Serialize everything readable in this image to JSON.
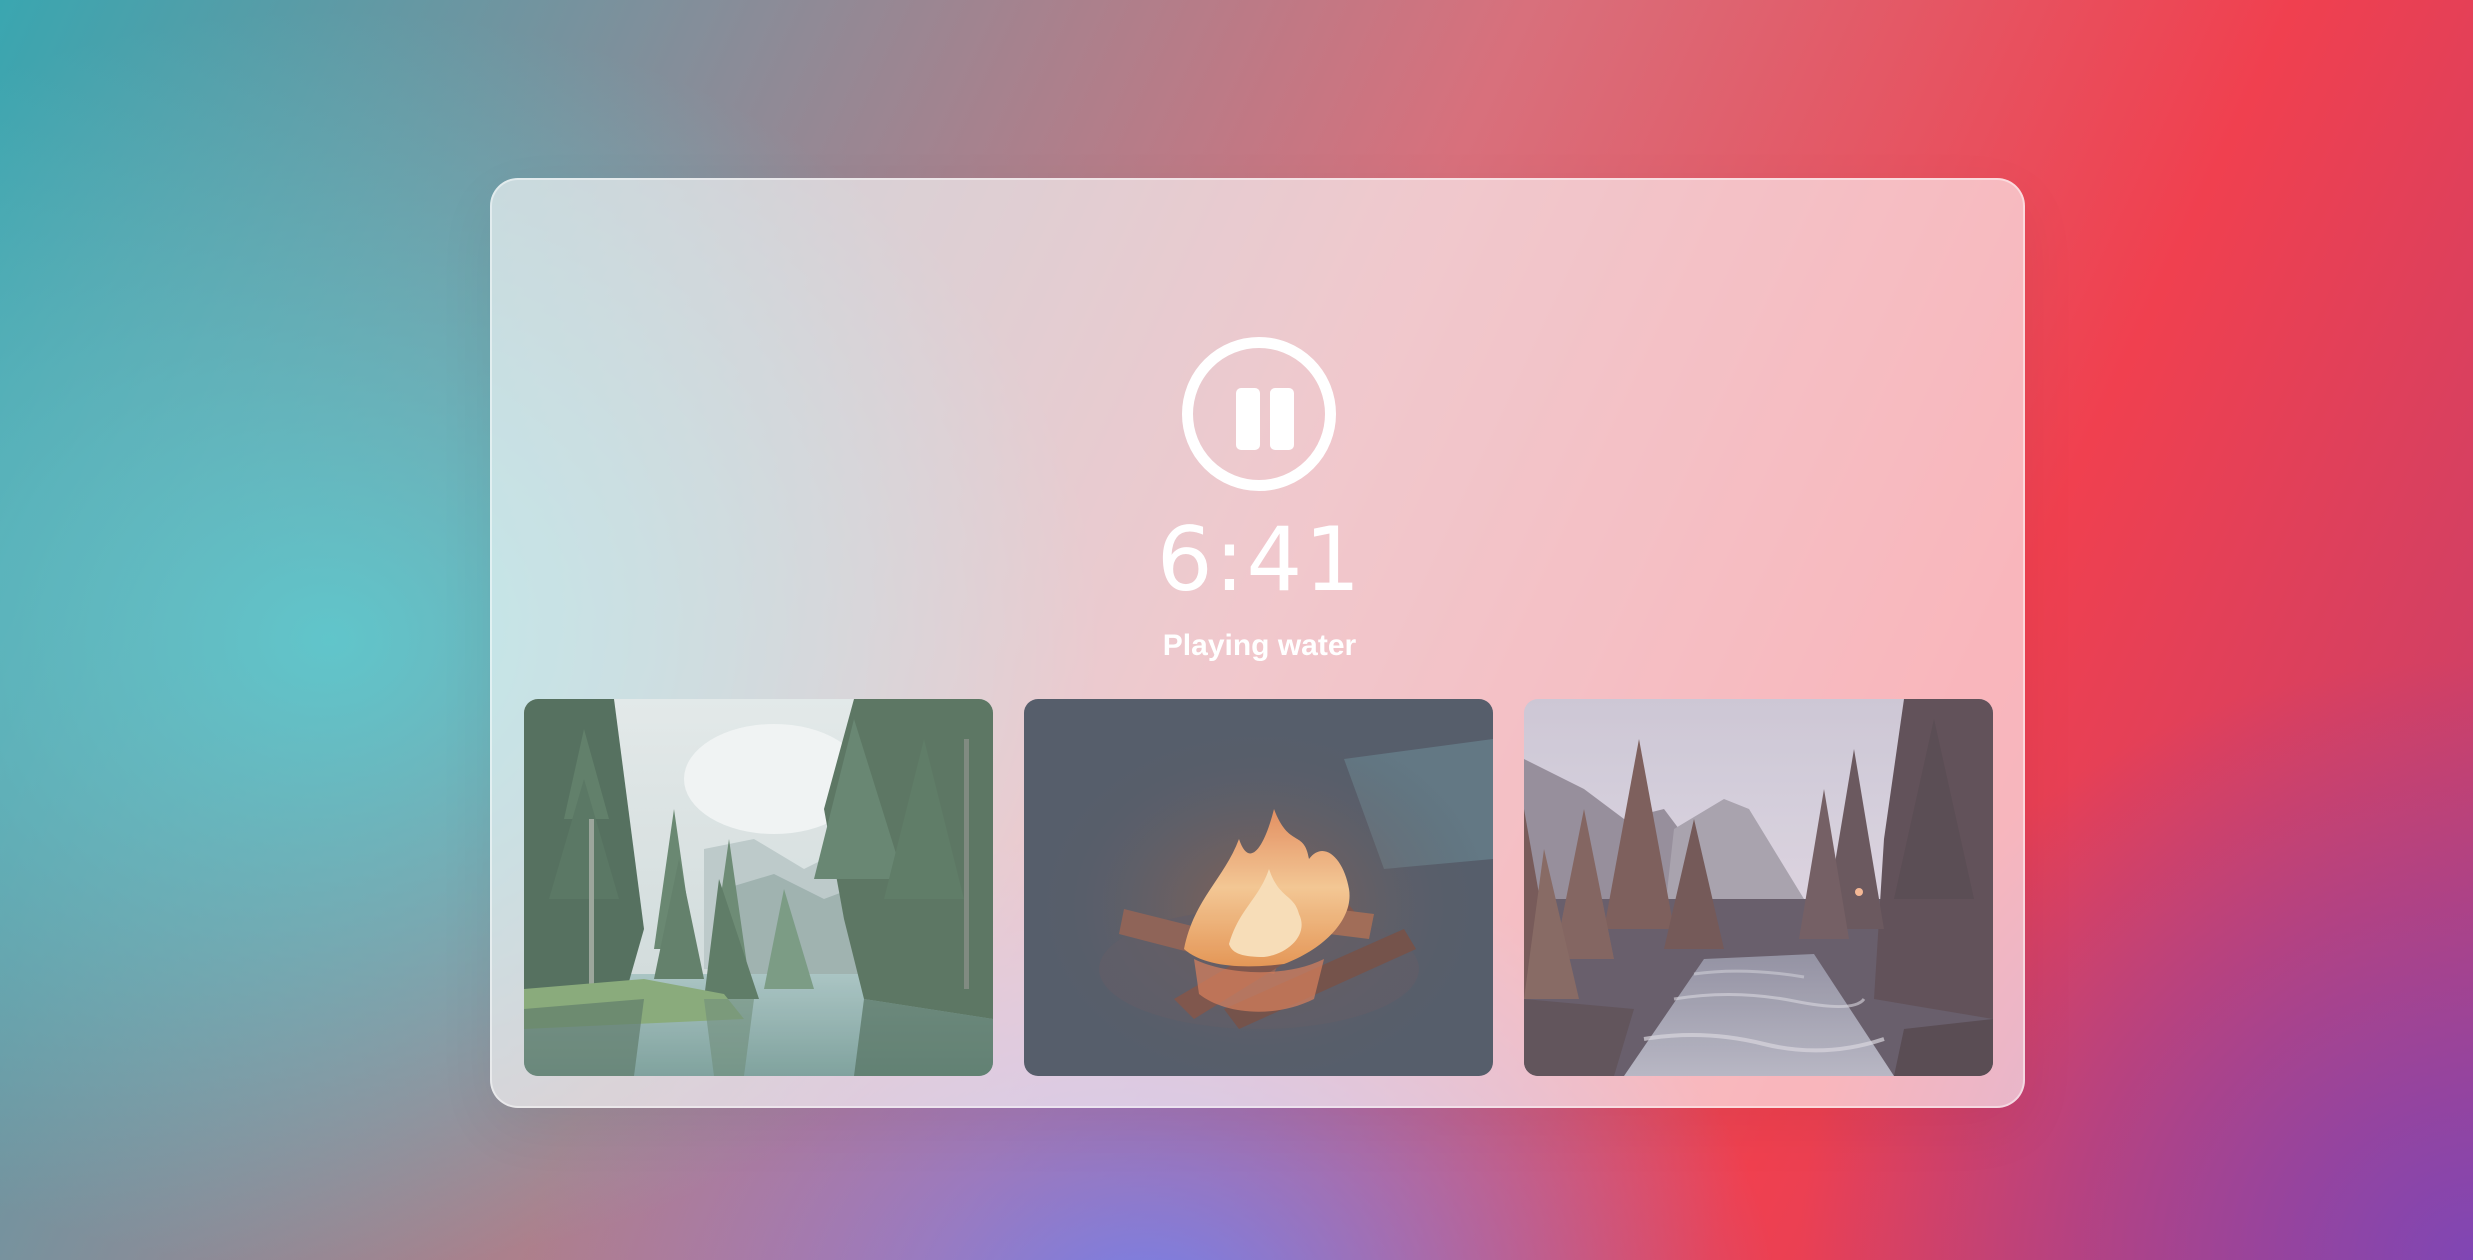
{
  "player": {
    "state": "playing",
    "control_icon": "pause-icon",
    "time": "6:41",
    "status_text": "Playing water"
  },
  "sounds": [
    {
      "id": "water",
      "scene": "forest lake with pine trees",
      "selected": true
    },
    {
      "id": "fire",
      "scene": "campfire at night",
      "selected": false
    },
    {
      "id": "river",
      "scene": "mountain valley river",
      "selected": false
    }
  ],
  "colors": {
    "background_left": "#3aa6b0",
    "background_right": "#f0404f",
    "background_bottom_right": "#8046b4",
    "card": "#ffffff",
    "text": "#ffffff"
  }
}
